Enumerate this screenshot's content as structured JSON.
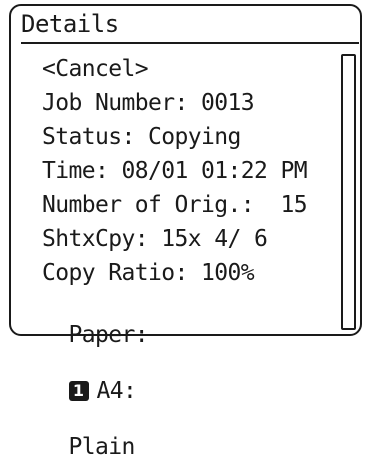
{
  "screen": {
    "title": "Details",
    "cancel": "<Cancel>",
    "rows": [
      "Job Number: 0013",
      "Status: Copying",
      "Time: 08/01 01:22 PM",
      "Number of Orig.:  15",
      "ShtxCpy: 15x 4/ 6",
      "Copy Ratio: 100%"
    ],
    "paper": {
      "label": "Paper:",
      "drawer": "1",
      "size": "A4:",
      "type": "Plain"
    }
  },
  "icons": {
    "drawer_badge": "paper-drawer-icon"
  },
  "colors": {
    "foreground": "#1a1a1a",
    "background": "#ffffff"
  }
}
